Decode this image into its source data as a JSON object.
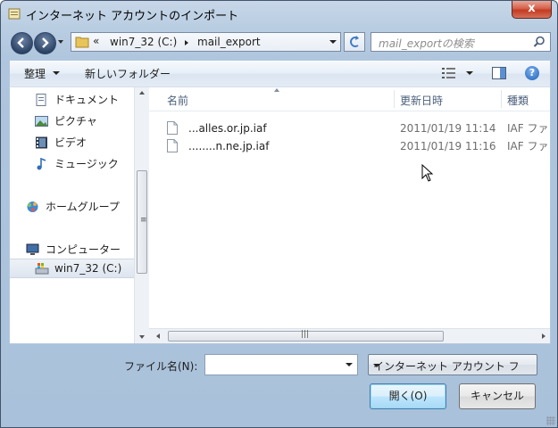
{
  "window": {
    "title": "インターネット アカウントのインポート",
    "close_label": "x"
  },
  "address": {
    "overflow_chevron": "«",
    "crumbs": [
      "win7_32 (C:)",
      "mail_export"
    ],
    "search_placeholder": "mail_exportの検索"
  },
  "toolbar": {
    "organize_label": "整理",
    "new_folder_label": "新しいフォルダー",
    "help_label": "?"
  },
  "nav": {
    "items": [
      {
        "label": "ドキュメント",
        "icon": "document-icon"
      },
      {
        "label": "ピクチャ",
        "icon": "picture-icon"
      },
      {
        "label": "ビデオ",
        "icon": "video-icon"
      },
      {
        "label": "ミュージック",
        "icon": "music-icon"
      }
    ],
    "homegroup": "ホームグループ",
    "computer": "コンピューター",
    "drive": "win7_32 (C:)"
  },
  "file_list": {
    "columns": [
      "名前",
      "更新日時",
      "種類"
    ],
    "rows": [
      {
        "name": "...alles.or.jp.iaf",
        "date": "2011/01/19 11:14",
        "type": "IAF ファ"
      },
      {
        "name": "........n.ne.jp.iaf",
        "date": "2011/01/19 11:16",
        "type": "IAF ファ"
      }
    ]
  },
  "footer": {
    "filename_label": "ファイル名(N):",
    "filename_value": "",
    "filter_value": "インターネット アカウント フ",
    "open_label": "開く(O)",
    "cancel_label": "キャンセル"
  }
}
